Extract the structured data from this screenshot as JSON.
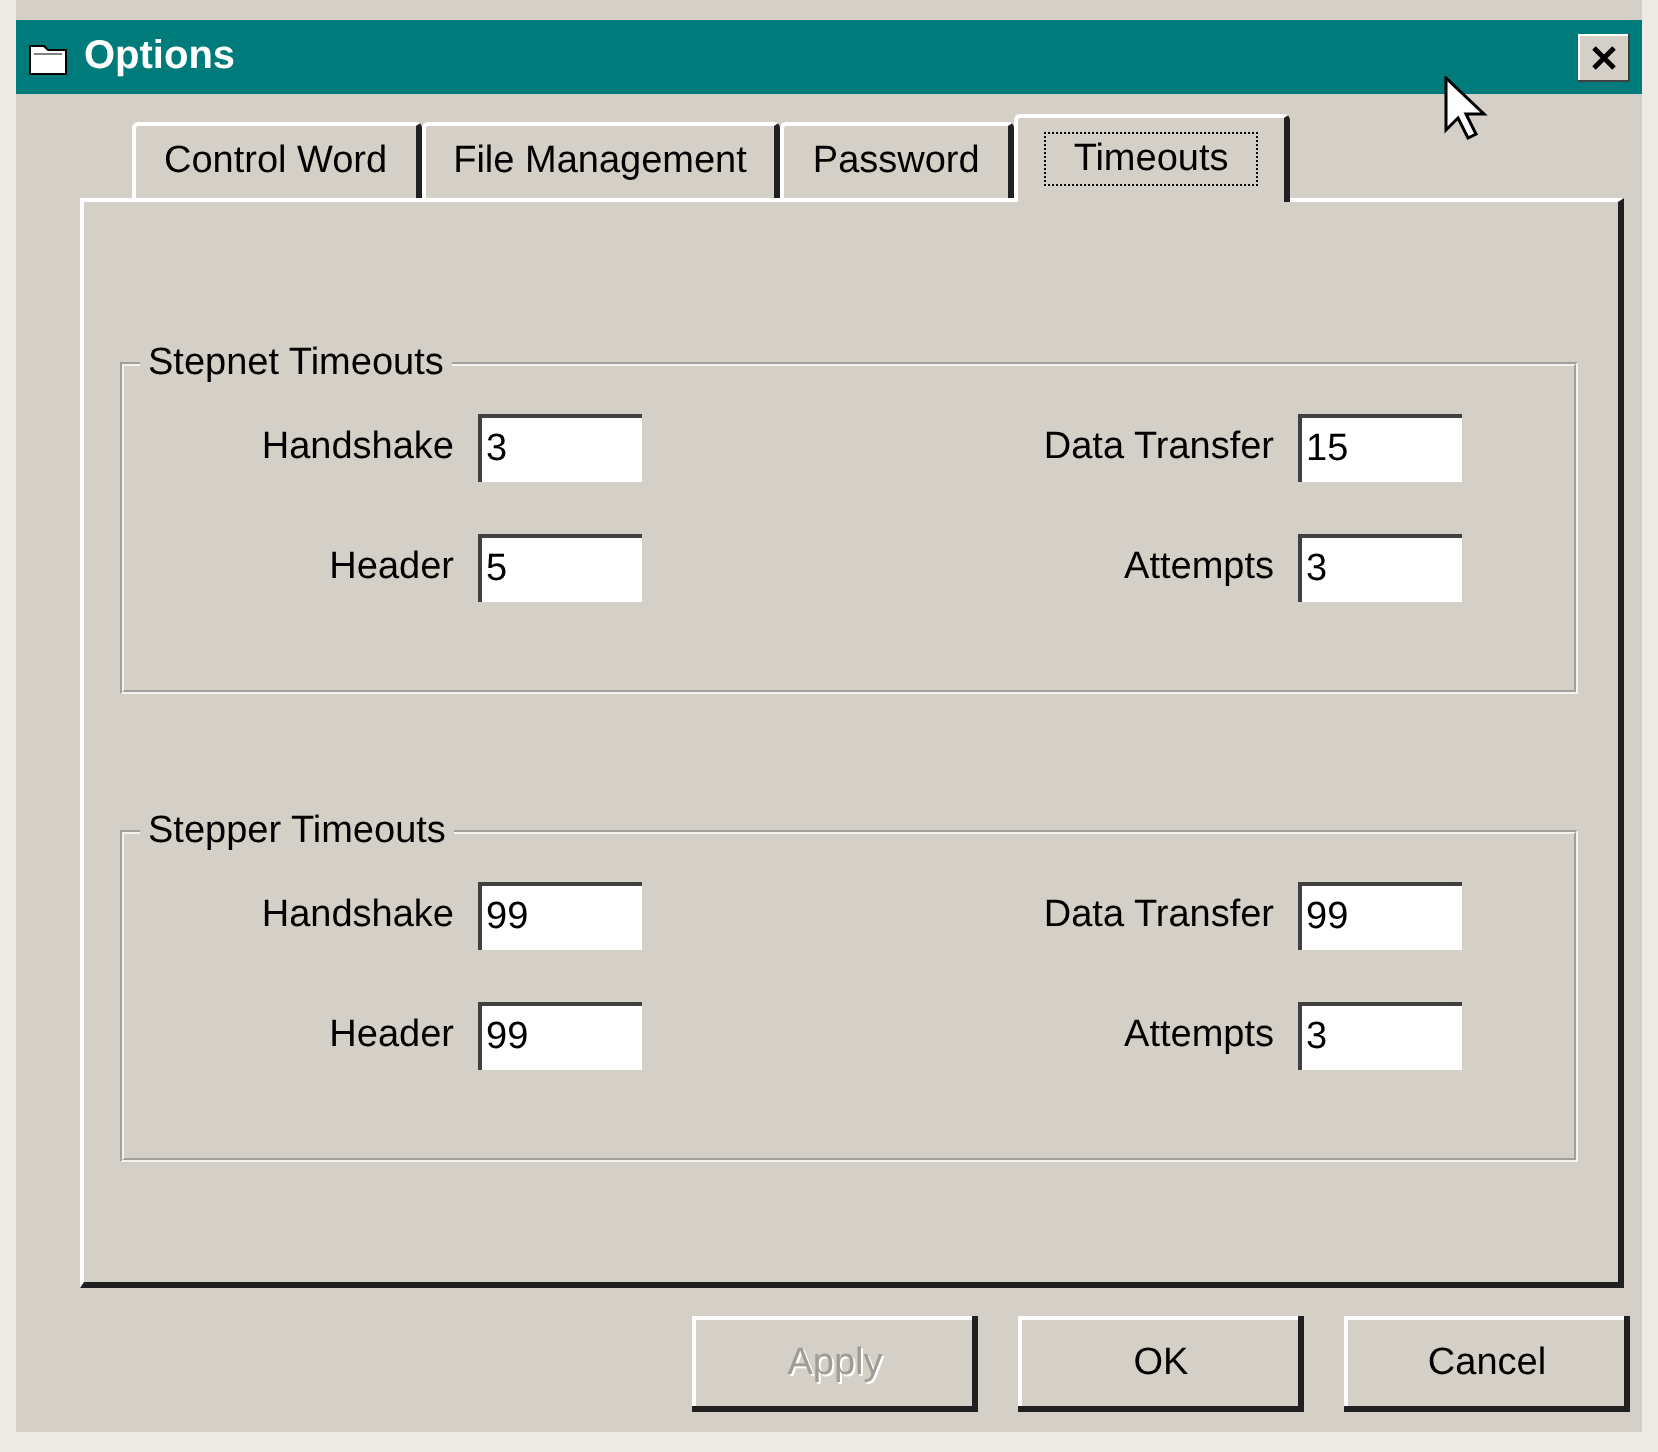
{
  "window": {
    "title": "Options"
  },
  "tabs": [
    {
      "label": "Control Word",
      "selected": false
    },
    {
      "label": "File Management",
      "selected": false
    },
    {
      "label": "Password",
      "selected": false
    },
    {
      "label": "Timeouts",
      "selected": true
    }
  ],
  "groups": [
    {
      "title": "Stepnet Timeouts",
      "fields": [
        {
          "label": "Handshake",
          "value": "3"
        },
        {
          "label": "Data Transfer",
          "value": "15"
        },
        {
          "label": "Header",
          "value": "5"
        },
        {
          "label": "Attempts",
          "value": "3"
        }
      ]
    },
    {
      "title": "Stepper Timeouts",
      "fields": [
        {
          "label": "Handshake",
          "value": "99"
        },
        {
          "label": "Data Transfer",
          "value": "99"
        },
        {
          "label": "Header",
          "value": "99"
        },
        {
          "label": "Attempts",
          "value": "3"
        }
      ]
    }
  ],
  "buttons": [
    {
      "label": "Apply",
      "disabled": true
    },
    {
      "label": "OK",
      "disabled": false
    },
    {
      "label": "Cancel",
      "disabled": false
    }
  ]
}
